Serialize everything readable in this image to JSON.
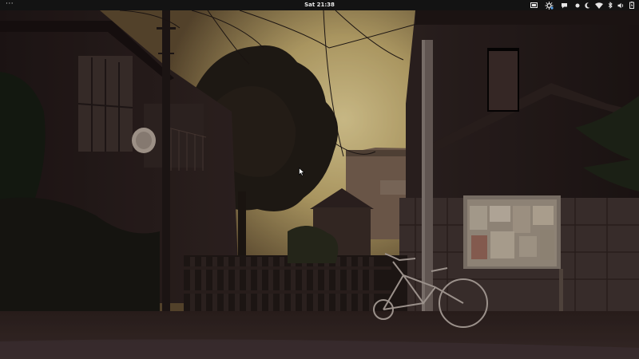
{
  "topbar": {
    "activities_label": "···",
    "clock": "Sat 21:38",
    "tray_icons": [
      "display-icon",
      "network-status-icon",
      "chat-icon",
      "dot-indicator-icon",
      "night-light-icon",
      "wifi-icon",
      "bluetooth-icon",
      "volume-icon",
      "battery-icon"
    ]
  },
  "desktop": {
    "wallpaper": "street-scene-photo"
  },
  "colors": {
    "topbar_bg": "#131313",
    "topbar_text": "#e6e6e6",
    "sky_bright": "#e8d79a",
    "sky_dark": "#6a5a38",
    "shadow": "#1b1312"
  }
}
